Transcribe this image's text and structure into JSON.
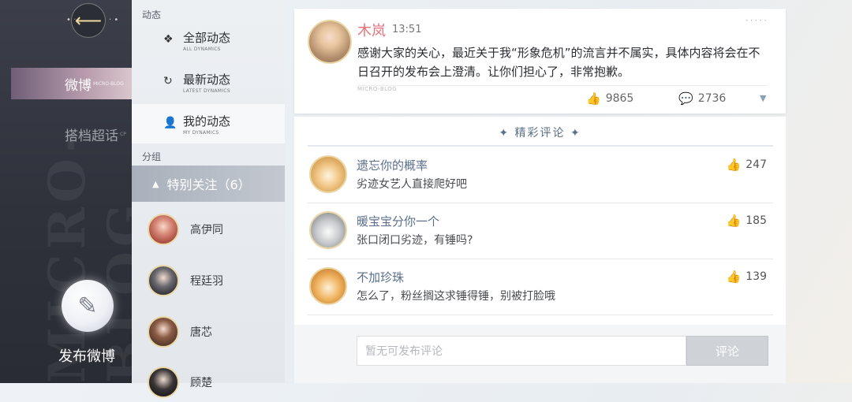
{
  "sidebar": {
    "back_icon": "arrow-left-icon",
    "items": [
      {
        "label": "微博",
        "sub": "MICRO-BLOG",
        "active": true
      },
      {
        "label": "搭档超话",
        "sub": "CP",
        "active": false
      }
    ],
    "post_button_label": "发布微博",
    "watermark": "MICRO-BLOG"
  },
  "nav": {
    "section_dynamics": "动态",
    "items": [
      {
        "label": "全部动态",
        "sub": "ALL DYNAMICS",
        "icon": "diamond-grid-icon"
      },
      {
        "label": "最新动态",
        "sub": "LATEST DYNAMICS",
        "icon": "refresh-icon"
      },
      {
        "label": "我的动态",
        "sub": "MY DYNAMICS",
        "icon": "person-icon"
      }
    ],
    "section_groups": "分组",
    "group": {
      "label": "特别关注（6）"
    },
    "contacts": [
      {
        "name": "高伊同"
      },
      {
        "name": "程廷羽"
      },
      {
        "name": "唐芯"
      },
      {
        "name": "顾楚"
      }
    ]
  },
  "post": {
    "author": "木岚",
    "time": "13:51",
    "content": "感谢大家的关心，最近关于我“形象危机”的流言并不属实，具体内容将会在不日召开的发布会上澄清。让你们担心了，非常抱歉。",
    "brand": "MICRO-BLOG",
    "likes": "9865",
    "comments": "2736"
  },
  "comments": {
    "title": "✦ 精彩评论 ✦",
    "items": [
      {
        "name": "遗忘你的概率",
        "text": "劣迹女艺人直接爬好吧",
        "likes": "247"
      },
      {
        "name": "暖宝宝分你一个",
        "text": "张口闭口劣迹，有锤吗?",
        "likes": "185"
      },
      {
        "name": "不加珍珠",
        "text": "怎么了，粉丝搁这求锤得锤，别被打脸哦",
        "likes": "139"
      }
    ],
    "input_placeholder": "暂无可发布评论",
    "submit_label": "评论"
  },
  "colors": {
    "author": "#e5737d",
    "commenter": "#5a6e8c",
    "rail_bg": "#2f323b",
    "accent_gold": "#e9d7a6"
  }
}
